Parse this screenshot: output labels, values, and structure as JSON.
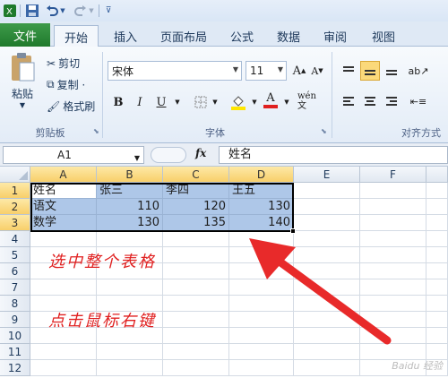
{
  "qat": {
    "items": [
      "save-icon",
      "undo-icon",
      "redo-icon",
      "customize-icon"
    ]
  },
  "tabs": {
    "file": "文件",
    "items": [
      "开始",
      "插入",
      "页面布局",
      "公式",
      "数据",
      "审阅",
      "视图"
    ],
    "active": "开始"
  },
  "ribbon": {
    "clipboard": {
      "label": "剪贴板",
      "paste": "粘贴",
      "cut": "剪切",
      "copy": "复制 ·",
      "format_painter": "格式刷"
    },
    "font": {
      "label": "字体",
      "name": "宋体",
      "size": "11",
      "grow": "A",
      "shrink": "A",
      "bold": "B",
      "italic": "I",
      "underline": "U",
      "phonetic": "wén 文"
    },
    "alignment": {
      "label": "对齐方式"
    }
  },
  "formula_bar": {
    "name_box": "A1",
    "fx": "fx",
    "content": "姓名"
  },
  "grid": {
    "columns": [
      "A",
      "B",
      "C",
      "D",
      "E",
      "F"
    ],
    "rows": [
      "1",
      "2",
      "3",
      "4",
      "5",
      "6",
      "7",
      "8",
      "9",
      "10",
      "11",
      "12"
    ],
    "cells": [
      [
        "姓名",
        "张三",
        "李四",
        "王五"
      ],
      [
        "语文",
        "110",
        "120",
        "130"
      ],
      [
        "数学",
        "130",
        "135",
        "140"
      ]
    ]
  },
  "annotation": {
    "line1": "选中整个表格",
    "line2": "点击鼠标右键",
    "arrow_color": "#e82a2a"
  },
  "watermark": "Baidu 经验",
  "colors": {
    "selection": "#aec7e8",
    "file_tab": "#1f7a2c",
    "header_selected": "#f8cf6a"
  }
}
